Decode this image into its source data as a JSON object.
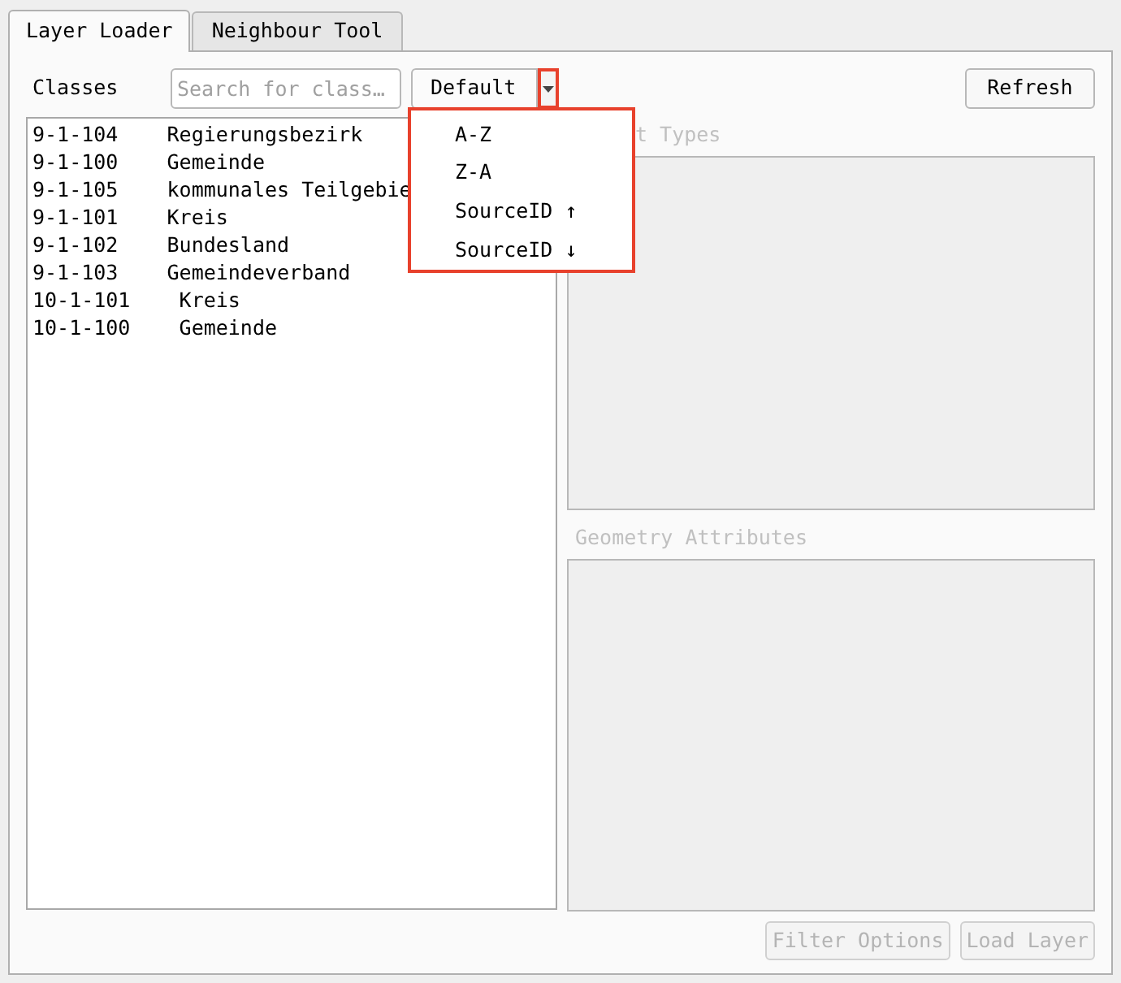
{
  "tabs": [
    {
      "label": "Layer Loader",
      "selected": true
    },
    {
      "label": "Neighbour Tool",
      "selected": false
    }
  ],
  "classes_label": "Classes",
  "search": {
    "placeholder": "Search for class…"
  },
  "sort_combo": {
    "value": "Default",
    "highlighted": true,
    "expanded": true,
    "options": [
      {
        "label": "A-Z"
      },
      {
        "label": "Z-A"
      },
      {
        "label": "SourceID ↑"
      },
      {
        "label": "SourceID ↓"
      }
    ]
  },
  "refresh_button": {
    "label": "Refresh",
    "disabled": false
  },
  "class_list": [
    {
      "text": "9-1-104    Regierungsbezirk"
    },
    {
      "text": "9-1-100    Gemeinde"
    },
    {
      "text": "9-1-105    kommunales Teilgebie"
    },
    {
      "text": "9-1-101    Kreis"
    },
    {
      "text": "9-1-102    Bundesland"
    },
    {
      "text": "9-1-103    Gemeindeverband"
    },
    {
      "text": "10-1-101    Kreis"
    },
    {
      "text": "10-1-100    Gemeinde"
    }
  ],
  "feature_types_label": "t Types",
  "geometry_label": "Geometry Attributes",
  "buttons": [
    {
      "label": "Filter Options",
      "disabled": true
    },
    {
      "label": "Load Layer",
      "disabled": true
    }
  ]
}
